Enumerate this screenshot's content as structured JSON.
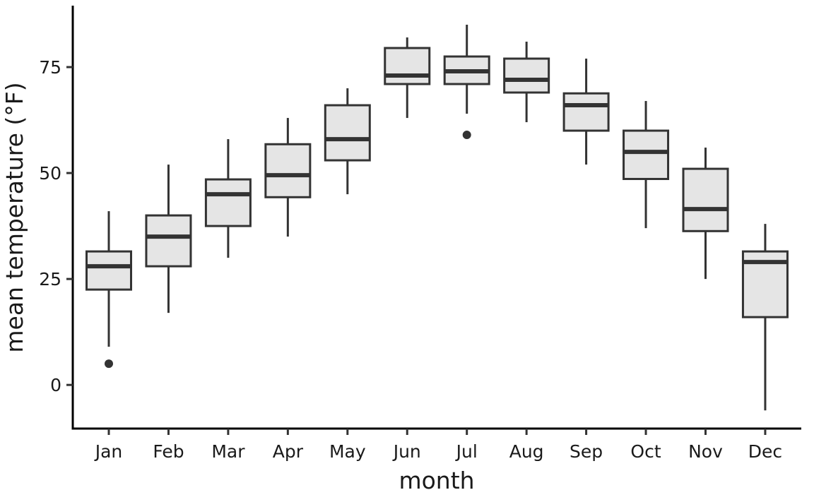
{
  "chart_data": {
    "type": "boxplot",
    "title": "",
    "xlabel": "month",
    "ylabel": "mean temperature (°F)",
    "ylim": [
      -10.3,
      89.5
    ],
    "yticks": [
      0,
      25,
      50,
      75
    ],
    "grid": false,
    "legend": "none",
    "colors": {
      "box_fill": "#e5e5e5",
      "stroke": "#333333",
      "axis": "#000000"
    },
    "categories": [
      "Jan",
      "Feb",
      "Mar",
      "Apr",
      "May",
      "Jun",
      "Jul",
      "Aug",
      "Sep",
      "Oct",
      "Nov",
      "Dec"
    ],
    "boxes": [
      {
        "month": "Jan",
        "whisker_low": 9,
        "q1": 22.5,
        "median": 28,
        "q3": 31.5,
        "whisker_high": 41,
        "outliers": [
          5
        ]
      },
      {
        "month": "Feb",
        "whisker_low": 17,
        "q1": 28,
        "median": 35,
        "q3": 40,
        "whisker_high": 52,
        "outliers": []
      },
      {
        "month": "Mar",
        "whisker_low": 30,
        "q1": 37.5,
        "median": 45,
        "q3": 48.5,
        "whisker_high": 58,
        "outliers": []
      },
      {
        "month": "Apr",
        "whisker_low": 35,
        "q1": 44.3,
        "median": 49.5,
        "q3": 56.8,
        "whisker_high": 63,
        "outliers": []
      },
      {
        "month": "May",
        "whisker_low": 45,
        "q1": 53,
        "median": 58,
        "q3": 66,
        "whisker_high": 70,
        "outliers": []
      },
      {
        "month": "Jun",
        "whisker_low": 63,
        "q1": 71,
        "median": 73,
        "q3": 79.5,
        "whisker_high": 82,
        "outliers": []
      },
      {
        "month": "Jul",
        "whisker_low": 64,
        "q1": 71,
        "median": 74,
        "q3": 77.5,
        "whisker_high": 85,
        "outliers": [
          59
        ]
      },
      {
        "month": "Aug",
        "whisker_low": 62,
        "q1": 69,
        "median": 72,
        "q3": 77,
        "whisker_high": 81,
        "outliers": []
      },
      {
        "month": "Sep",
        "whisker_low": 52,
        "q1": 60,
        "median": 66,
        "q3": 68.8,
        "whisker_high": 77,
        "outliers": []
      },
      {
        "month": "Oct",
        "whisker_low": 37,
        "q1": 48.6,
        "median": 55,
        "q3": 60,
        "whisker_high": 67,
        "outliers": []
      },
      {
        "month": "Nov",
        "whisker_low": 25,
        "q1": 36.3,
        "median": 41.5,
        "q3": 51,
        "whisker_high": 56,
        "outliers": []
      },
      {
        "month": "Dec",
        "whisker_low": -6,
        "q1": 16,
        "median": 29,
        "q3": 31.5,
        "whisker_high": 38,
        "outliers": []
      }
    ]
  }
}
